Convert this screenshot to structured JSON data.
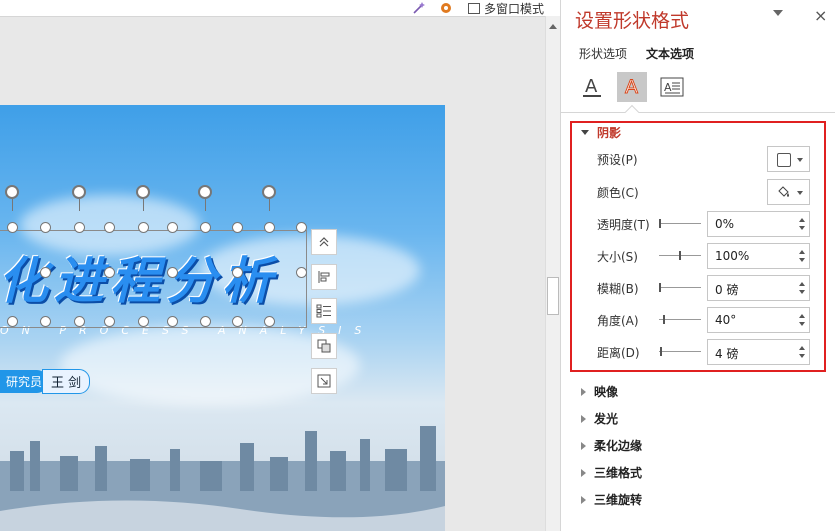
{
  "toolbar": {
    "multi_window_label": "多窗口模式",
    "icons": [
      "magic-wand-icon",
      "gear-icon",
      "multi-window-icon"
    ]
  },
  "slide": {
    "title_text": "化进程分析",
    "subtitle_text": "ON PROCESS ANALYSIS",
    "author_role": "研究员",
    "author_name": "王 剑",
    "accent_color": "#2a8ef0"
  },
  "pane": {
    "title": "设置形状格式",
    "close_glyph": "×",
    "tabs": {
      "shape_options": "形状选项",
      "text_options": "文本选项"
    },
    "category_icons": [
      "text-fill-outline-icon",
      "text-effects-icon",
      "text-box-layout-icon"
    ],
    "shadow": {
      "heading": "阴影",
      "fields": {
        "preset_label": "预设(P)",
        "color_label": "颜色(C)",
        "transparency_label": "透明度(T)",
        "transparency_value": "0%",
        "transparency_fraction": 0.0,
        "size_label": "大小(S)",
        "size_value": "100%",
        "size_fraction": 0.5,
        "blur_label": "模糊(B)",
        "blur_value": "0 磅",
        "blur_fraction": 0.0,
        "angle_label": "角度(A)",
        "angle_value": "40°",
        "angle_fraction": 0.11,
        "distance_label": "距离(D)",
        "distance_value": "4 磅",
        "distance_fraction": 0.02
      }
    },
    "collapsed_sections": [
      "映像",
      "发光",
      "柔化边缘",
      "三维格式",
      "三维旋转"
    ],
    "highlight_color": "#e02020",
    "title_color": "#c0392b"
  }
}
